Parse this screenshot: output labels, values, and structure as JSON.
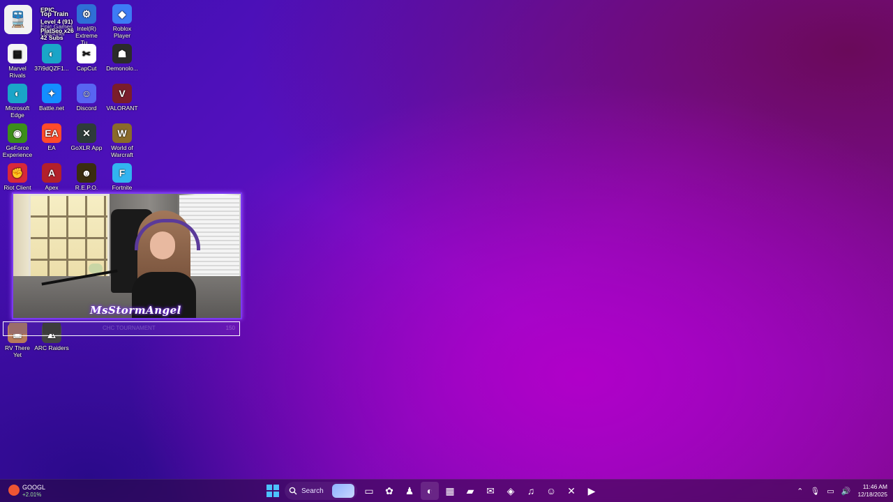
{
  "badge": {
    "line1": "Top Train",
    "line2": "Level 4 (91)",
    "line3": "42 Subs",
    "behind1": "EPIC",
    "behind2": "Epic Games Launcher",
    "behind3": "PlatSeo x26"
  },
  "desktop_icons": [
    {
      "label": "Intel(R) Extreme Tu...",
      "icon": "intel-icon",
      "color": "#2f6fd6",
      "glyph": "⚙"
    },
    {
      "label": "Roblox Player",
      "icon": "roblox-icon",
      "color": "#3d7bf5",
      "glyph": "◆"
    },
    {
      "label": "Marvel Rivals",
      "icon": "document-icon",
      "color": "#f5f5f5",
      "glyph": "▤"
    },
    {
      "label": "37i9dQZF1...",
      "icon": "edge-icon",
      "color": "#1aa5c8",
      "glyph": "◐"
    },
    {
      "label": "CapCut",
      "icon": "capcut-icon",
      "color": "#ffffff",
      "glyph": "✂"
    },
    {
      "label": "Demonolo...",
      "icon": "demonologist-icon",
      "color": "#2b2b2b",
      "glyph": "☗"
    },
    {
      "label": "Microsoft Edge",
      "icon": "edge-icon",
      "color": "#1aa5c8",
      "glyph": "◐"
    },
    {
      "label": "Battle.net",
      "icon": "battlenet-icon",
      "color": "#148eff",
      "glyph": "✦"
    },
    {
      "label": "Discord",
      "icon": "discord-icon",
      "color": "#5865f2",
      "glyph": "☺"
    },
    {
      "label": "VALORANT",
      "icon": "valorant-icon",
      "color": "#7a1d2c",
      "glyph": "V"
    },
    {
      "label": "GeForce Experience",
      "icon": "geforce-icon",
      "color": "#3c8f1a",
      "glyph": "◉"
    },
    {
      "label": "EA",
      "icon": "ea-icon",
      "color": "#ff4b2b",
      "glyph": "EA"
    },
    {
      "label": "GoXLR App",
      "icon": "goxlr-icon",
      "color": "#2e3b3a",
      "glyph": "✕"
    },
    {
      "label": "World of Warcraft",
      "icon": "warcraft-icon",
      "color": "#8a6a2a",
      "glyph": "W"
    },
    {
      "label": "Riot Client",
      "icon": "riot-icon",
      "color": "#d9283a",
      "glyph": "✊"
    },
    {
      "label": "Apex",
      "icon": "apex-icon",
      "color": "#b3202a",
      "glyph": "A"
    },
    {
      "label": "R.E.P.O.",
      "icon": "repo-icon",
      "color": "#3a2d10",
      "glyph": "☻"
    },
    {
      "label": "Fortnite",
      "icon": "fortnite-icon",
      "color": "#32b4f0",
      "glyph": "F"
    },
    {
      "label": "RV There Yet",
      "icon": "rv-icon",
      "color": "#b77a5a",
      "glyph": "▣"
    },
    {
      "label": "ARC Raiders",
      "icon": "arc-raiders-icon",
      "color": "#444444",
      "glyph": "◭"
    }
  ],
  "overlay": {
    "streamer_name": "MsStormAngel",
    "bar_text": "CHC TOURNAMENT",
    "bar_count": "150"
  },
  "taskbar": {
    "stock_name": "GOOGL",
    "stock_change": "+2.01%",
    "search_placeholder": "Search",
    "time": "11:46 AM",
    "date": "12/18/2025",
    "apps": [
      {
        "icon": "task-view-icon",
        "glyph": "▭"
      },
      {
        "icon": "copilot-icon",
        "glyph": "✿"
      },
      {
        "icon": "teams-icon",
        "glyph": "♟"
      },
      {
        "icon": "edge-icon",
        "glyph": "◐"
      },
      {
        "icon": "store-icon",
        "glyph": "▦"
      },
      {
        "icon": "file-explorer-icon",
        "glyph": "▰"
      },
      {
        "icon": "outlook-icon",
        "glyph": "✉"
      },
      {
        "icon": "clipchamp-icon",
        "glyph": "◈"
      },
      {
        "icon": "spotify-icon",
        "glyph": "♫"
      },
      {
        "icon": "discord-icon",
        "glyph": "☺"
      },
      {
        "icon": "excel-icon",
        "glyph": "✕"
      },
      {
        "icon": "clapper-icon",
        "glyph": "▶"
      }
    ]
  }
}
